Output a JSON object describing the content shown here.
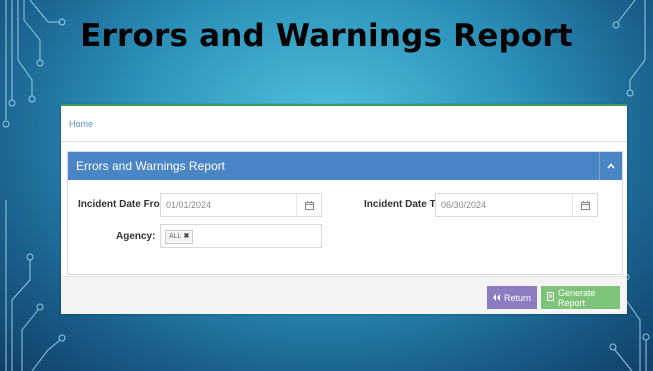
{
  "slide": {
    "title": "Errors and Warnings Report"
  },
  "app": {
    "breadcrumb": "Home",
    "panel": {
      "title": "Errors and Warnings Report",
      "collapse_icon": "chevron-up-icon",
      "fields": {
        "date_from_label": "Incident Date From:",
        "date_from_value": "01/01/2024",
        "date_to_label": "Incident Date To:",
        "date_to_value": "06/30/2024",
        "agency_label": "Agency:",
        "agency_tag": "ALL",
        "agency_tag_remove": "✖"
      }
    },
    "footer": {
      "return_label": "Return",
      "generate_label": "Generate Report"
    }
  },
  "colors": {
    "panel_header": "#4a85c5",
    "return_button": "#8e7cc3",
    "generate_button": "#7ec37a",
    "accent_top": "#3d9b5a"
  }
}
